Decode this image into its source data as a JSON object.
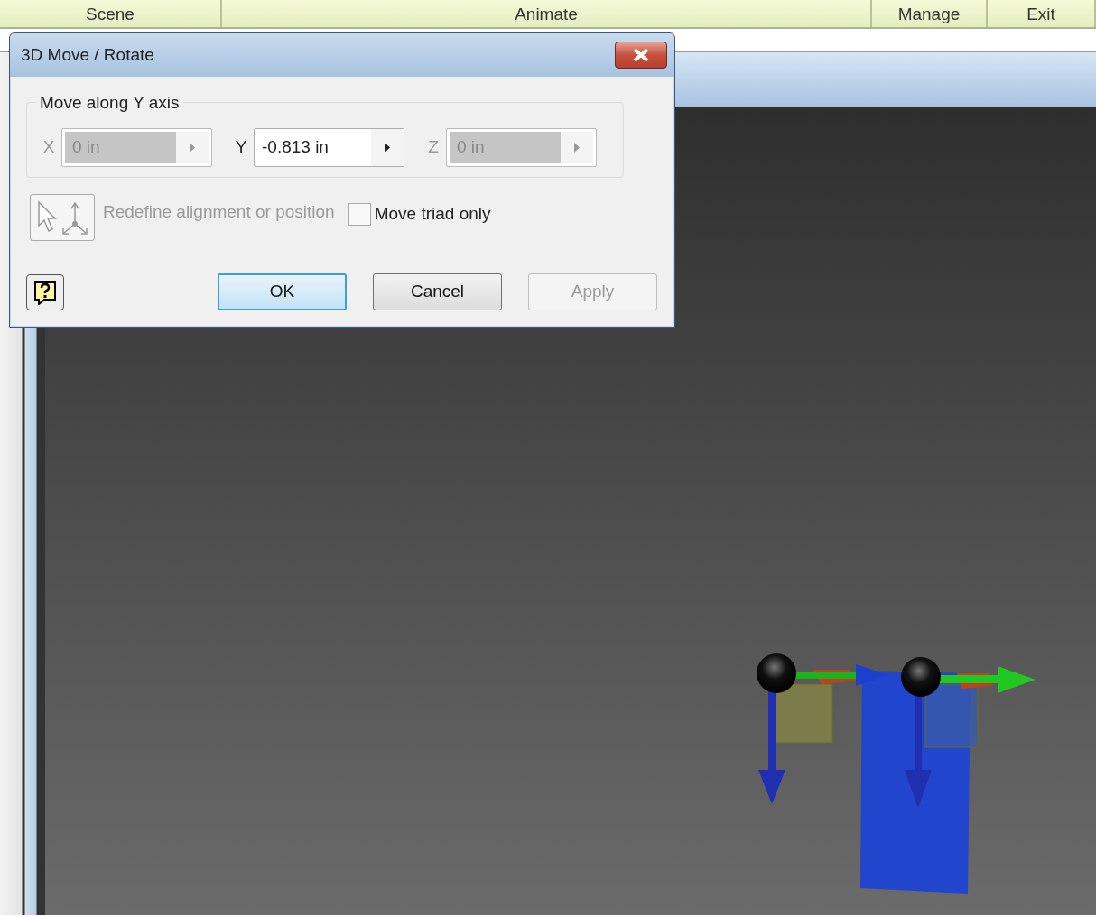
{
  "menu_tabs": [
    {
      "label": "Scene"
    },
    {
      "label": "Animate"
    },
    {
      "label": "Manage"
    },
    {
      "label": "Exit"
    }
  ],
  "dialog": {
    "title": "3D Move / Rotate",
    "group_label": "Move along Y axis",
    "fields": [
      {
        "axis": "X",
        "value": "0 in",
        "disabled": true
      },
      {
        "axis": "Y",
        "value": "-0.813 in",
        "disabled": false
      },
      {
        "axis": "Z",
        "value": "0 in",
        "disabled": true
      }
    ],
    "redefine": {
      "label": "Redefine alignment or position",
      "disabled": true
    },
    "move_triad_only": {
      "label": "Move triad only",
      "checked": false
    },
    "buttons": [
      {
        "label": "OK",
        "default": true,
        "disabled": false
      },
      {
        "label": "Cancel",
        "default": false,
        "disabled": false
      },
      {
        "label": "Apply",
        "default": false,
        "disabled": true
      }
    ]
  }
}
